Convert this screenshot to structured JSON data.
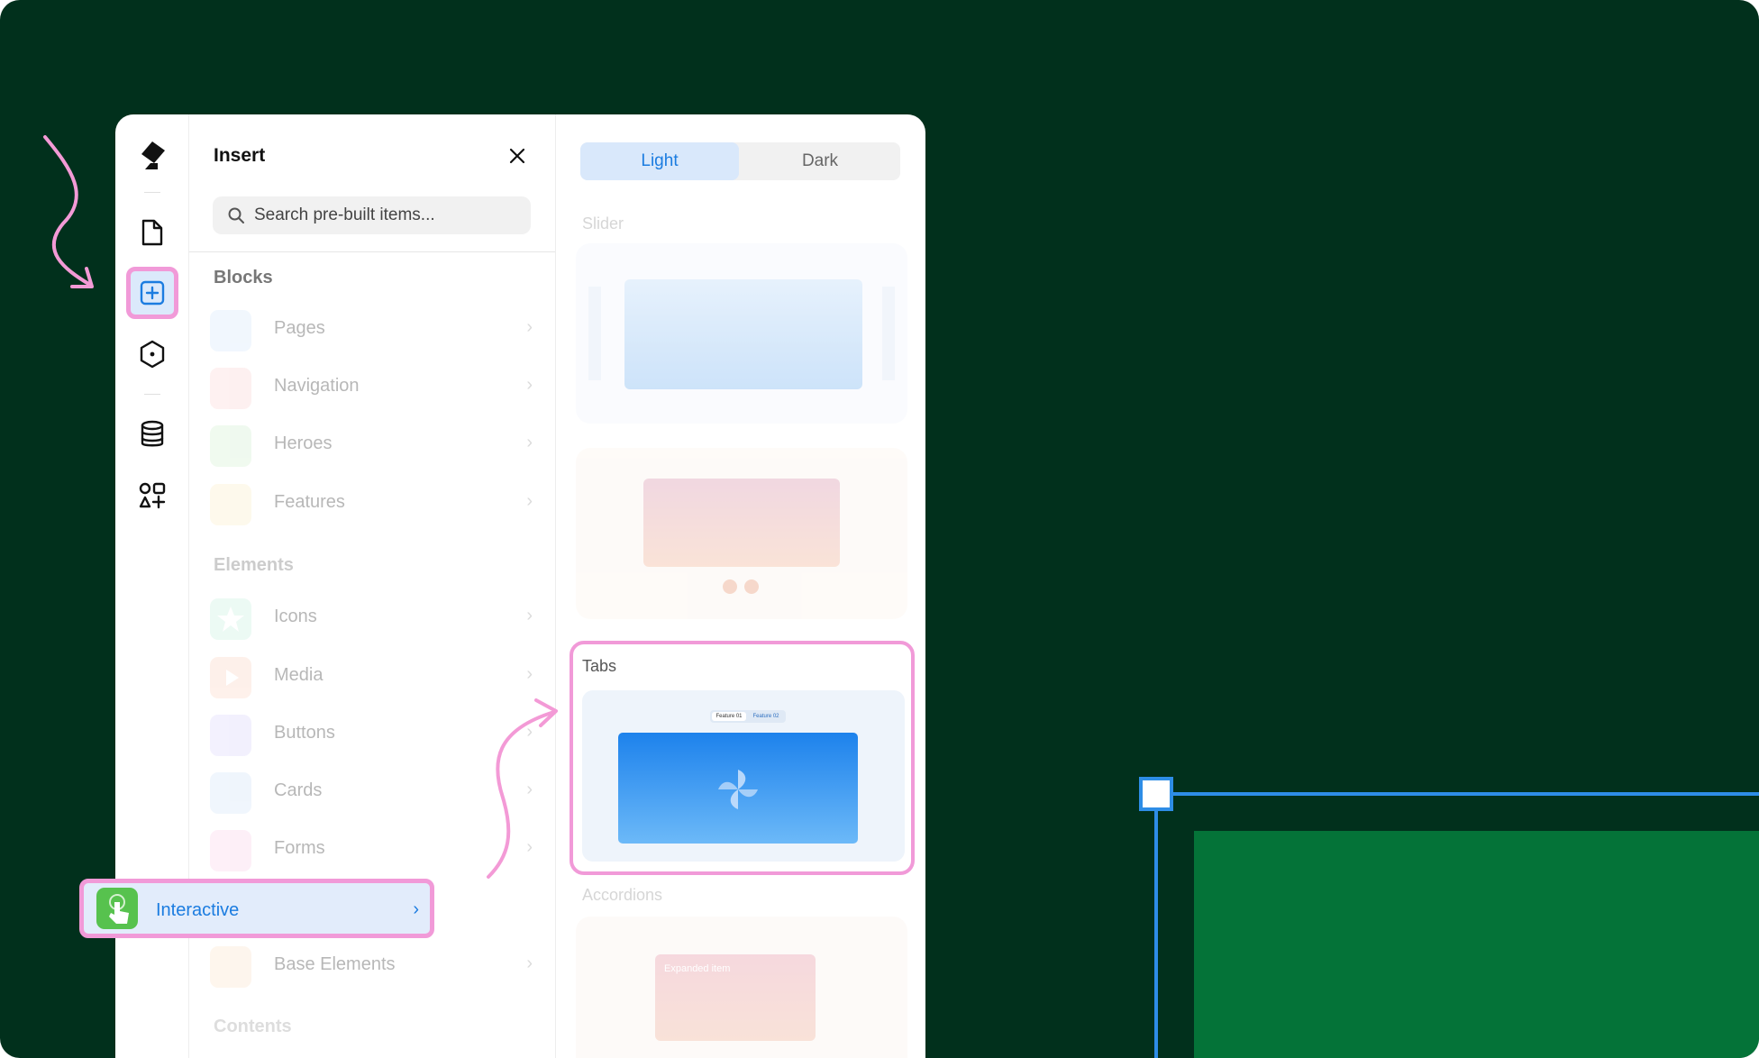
{
  "panel": {
    "title": "Insert",
    "search_placeholder": "Search pre-built items..."
  },
  "rail": {
    "items": [
      {
        "name": "logo",
        "icon": "framer-logo-icon"
      },
      {
        "name": "pages",
        "icon": "page-icon"
      },
      {
        "name": "insert",
        "icon": "plus-square-icon",
        "active": true
      },
      {
        "name": "components",
        "icon": "hexagon-icon"
      },
      {
        "name": "cms",
        "icon": "database-icon"
      },
      {
        "name": "assets",
        "icon": "shapes-icon"
      }
    ]
  },
  "sections": {
    "blocks": "Blocks",
    "elements": "Elements",
    "contents": "Contents"
  },
  "blocks": [
    {
      "label": "Pages",
      "color": "#5aa2f0"
    },
    {
      "label": "Navigation",
      "color": "#f07b7b"
    },
    {
      "label": "Heroes",
      "color": "#6bcb6f"
    },
    {
      "label": "Features",
      "color": "#f3c35a"
    }
  ],
  "elements": [
    {
      "label": "Icons",
      "color": "#4fd19d"
    },
    {
      "label": "Media",
      "color": "#f5855b"
    },
    {
      "label": "Buttons",
      "color": "#9a8cf0"
    },
    {
      "label": "Cards",
      "color": "#6fa6e8"
    },
    {
      "label": "Forms",
      "color": "#f27fb8"
    },
    {
      "label": "Interactive",
      "color": "#57c24e",
      "active": true
    },
    {
      "label": "Base Elements",
      "color": "#f3b97a"
    }
  ],
  "chevron": "›",
  "preview": {
    "toggle_light": "Light",
    "toggle_dark": "Dark",
    "slider_label": "Slider",
    "tabs_label": "Tabs",
    "accordions_label": "Accordions",
    "tab1": "Feature 01",
    "tab2": "Feature 02",
    "accordion_card_title": "Expanded item"
  },
  "colors": {
    "background": "#01301c",
    "highlight": "#f19ad8",
    "accent": "#1b7ce0",
    "selection": "#2e8de6",
    "canvas_block": "#047338"
  }
}
